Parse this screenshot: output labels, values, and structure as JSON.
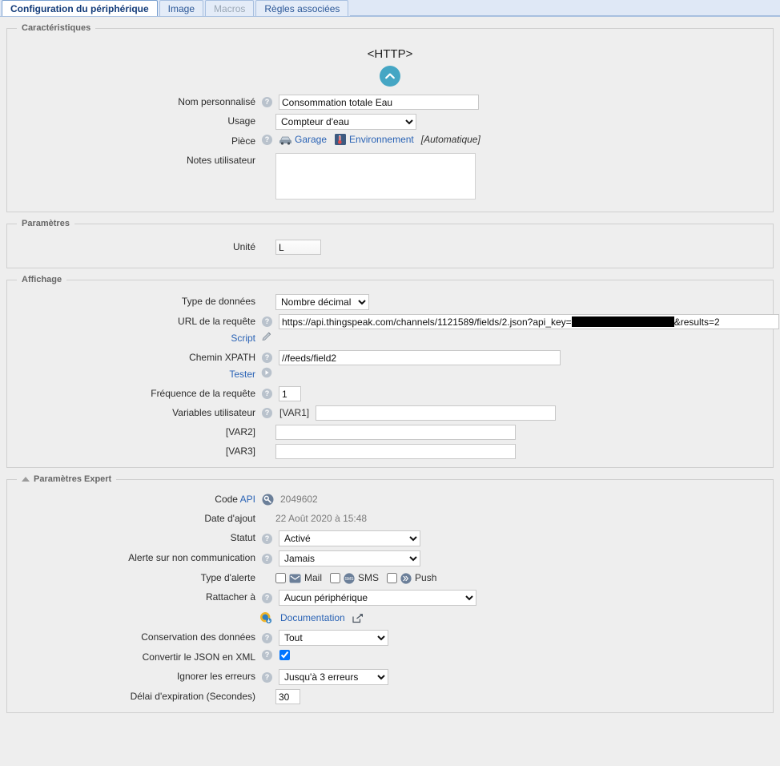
{
  "tabs": [
    {
      "label": "Configuration du périphérique",
      "state": "active"
    },
    {
      "label": "Image",
      "state": "normal"
    },
    {
      "label": "Macros",
      "state": "disabled"
    },
    {
      "label": "Règles associées",
      "state": "normal"
    }
  ],
  "sections": {
    "caracteristiques": {
      "legend": "Caractéristiques",
      "device_type": "<HTTP>",
      "icon": "chevron-up-circle-icon",
      "accent_color": "#45a6c4",
      "fields": {
        "nom_label": "Nom personnalisé",
        "nom_value": "Consommation totale Eau",
        "usage_label": "Usage",
        "usage_value": "Compteur d'eau",
        "usage_options": [
          "Compteur d'eau"
        ],
        "piece_label": "Pièce",
        "piece_room": "Garage",
        "piece_group": "Environnement",
        "piece_auto": "[Automatique]",
        "notes_label": "Notes utilisateur",
        "notes_value": ""
      }
    },
    "parametres": {
      "legend": "Paramètres",
      "fields": {
        "unite_label": "Unité",
        "unite_value": "L"
      }
    },
    "affichage": {
      "legend": "Affichage",
      "fields": {
        "type_donnees_label": "Type de données",
        "type_donnees_value": "Nombre décimal",
        "type_donnees_options": [
          "Nombre décimal"
        ],
        "url_label": "URL de la requête",
        "url_prefix": "https://api.thingspeak.com/channels/1121589/fields/2.json?api_key=",
        "url_redacted": true,
        "url_suffix": "&results=2",
        "script_label": "Script",
        "script_icon": "pencil-icon",
        "xpath_label": "Chemin XPATH",
        "xpath_value": "//feeds/field2",
        "tester_label": "Tester",
        "tester_icon": "play-icon",
        "frequence_label": "Fréquence de la requête",
        "frequence_value": "1",
        "variables_label": "Variables utilisateur",
        "var1_label": "[VAR1]",
        "var1_value": "",
        "var2_label": "[VAR2]",
        "var2_value": "",
        "var3_label": "[VAR3]",
        "var3_value": ""
      }
    },
    "expert": {
      "legend": "Paramètres Expert",
      "fields": {
        "code_label": "Code",
        "code_link": "API",
        "code_icon": "key-icon",
        "code_value": "2049602",
        "date_label": "Date d'ajout",
        "date_value": "22 Août 2020 à 15:48",
        "statut_label": "Statut",
        "statut_value": "Activé",
        "statut_options": [
          "Activé"
        ],
        "alerte_noncom_label": "Alerte sur non communication",
        "alerte_noncom_value": "Jamais",
        "alerte_noncom_options": [
          "Jamais"
        ],
        "type_alerte_label": "Type d'alerte",
        "alert_mail_label": "Mail",
        "alert_mail_checked": false,
        "alert_mail_icon": "envelope-icon",
        "alert_sms_label": "SMS",
        "alert_sms_checked": false,
        "alert_sms_icon": "sms-icon",
        "alert_push_label": "Push",
        "alert_push_checked": false,
        "alert_push_icon": "push-chevrons-icon",
        "rattacher_label": "Rattacher à",
        "rattacher_value": "Aucun périphérique",
        "rattacher_options": [
          "Aucun périphérique"
        ],
        "documentation_label": "Documentation",
        "documentation_icon": "help-globe-icon",
        "documentation_external_icon": "external-link-icon",
        "conservation_label": "Conservation des données",
        "conservation_value": "Tout",
        "conservation_options": [
          "Tout"
        ],
        "json_xml_label": "Convertir le JSON en XML",
        "json_xml_checked": true,
        "ignorer_label": "Ignorer les erreurs",
        "ignorer_value": "Jusqu'à 3 erreurs",
        "ignorer_options": [
          "Jusqu'à 3 erreurs"
        ],
        "delai_label": "Délai d'expiration (Secondes)",
        "delai_value": "30"
      }
    }
  },
  "colors": {
    "link": "#2a63b5",
    "accent": "#45a6c4",
    "checkbox_checked": "#1a73e8",
    "background": "#eeeeee"
  }
}
